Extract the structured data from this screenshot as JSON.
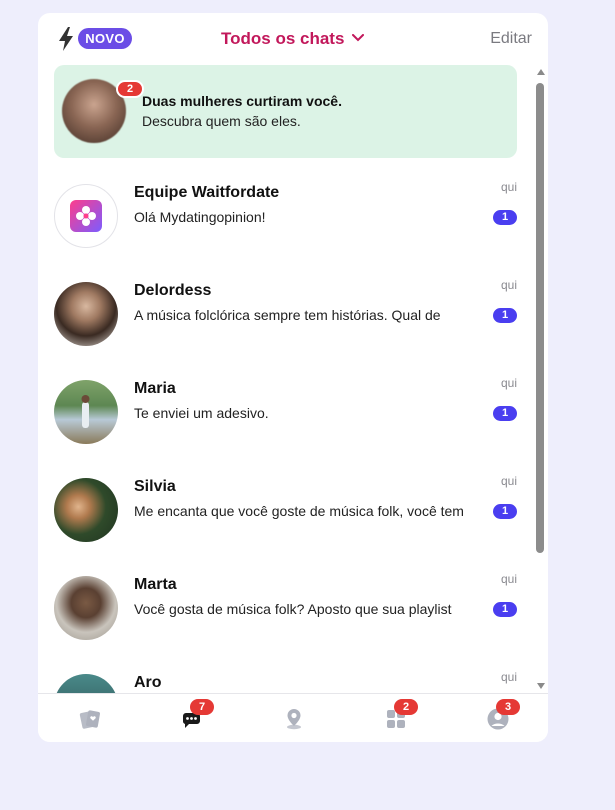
{
  "header": {
    "new_badge": "NOVO",
    "filter_label": "Todos os chats",
    "edit_label": "Editar"
  },
  "promo": {
    "badge": "2",
    "title": "Duas mulheres curtiram você.",
    "subtitle": "Descubra quem são eles."
  },
  "chats": [
    {
      "name": "Equipe Waitfordate",
      "preview": "Olá Mydatingopinion!",
      "time": "qui",
      "unread": "1"
    },
    {
      "name": "Delordess",
      "preview": "A música folclórica sempre tem histórias. Qual de",
      "time": "qui",
      "unread": "1"
    },
    {
      "name": "Maria",
      "preview": "Te enviei um adesivo.",
      "time": "qui",
      "unread": "1"
    },
    {
      "name": "Silvia",
      "preview": "Me encanta que você goste de música folk, você tem",
      "time": "qui",
      "unread": "1"
    },
    {
      "name": "Marta",
      "preview": "Você gosta de música folk? Aposto que sua playlist",
      "time": "qui",
      "unread": "1"
    },
    {
      "name": "Aro",
      "preview": "",
      "time": "qui",
      "unread": ""
    }
  ],
  "nav": {
    "chats_badge": "7",
    "apps_badge": "2",
    "profile_badge": "3"
  },
  "colors": {
    "accent": "#c2185b",
    "new_badge": "#6b4de6",
    "unread_badge": "#4a3ef0",
    "alert_badge": "#e53935",
    "promo_bg": "#dcf3e6"
  }
}
